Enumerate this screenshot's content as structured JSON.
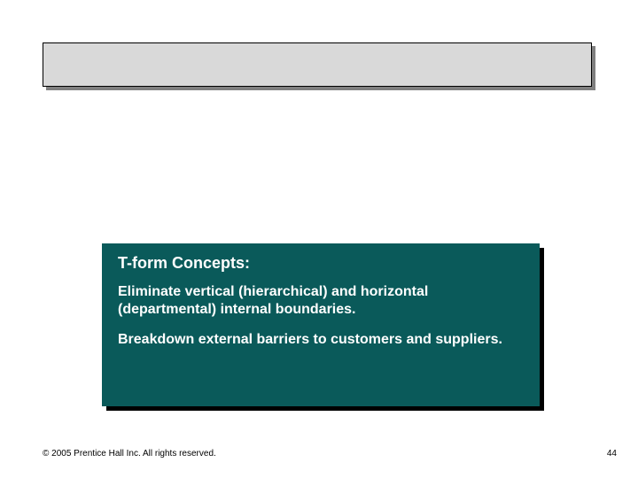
{
  "title_bar": "",
  "concept": {
    "heading": "T-form Concepts:",
    "para1": "Eliminate vertical (hierarchical) and horizontal (departmental) internal boundaries.",
    "para2": "Breakdown external barriers to customers and suppliers."
  },
  "footer": {
    "left": "© 2005 Prentice Hall Inc. All rights reserved.",
    "right": "44"
  }
}
